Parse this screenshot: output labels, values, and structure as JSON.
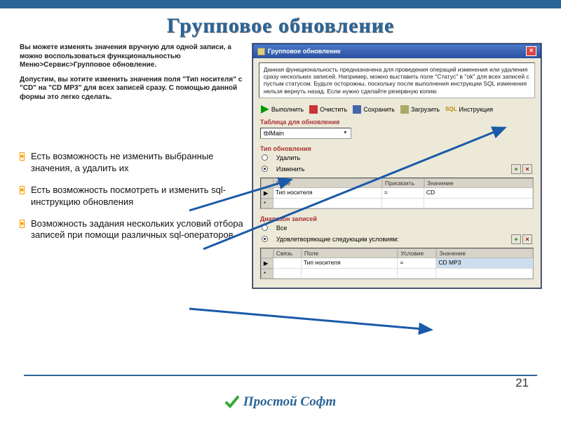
{
  "title": "Групповое обновление",
  "intro": {
    "p1": "Вы можете изменять значения вручную для одной записи, а можно воспользоваться функциональностью Меню>Сервис>Групповое обновление.",
    "p2": "Допустим, вы хотите изменить значения поля \"Тип носителя\" с \"CD\" на \"CD MP3\" для всех записей сразу. С помощью данной формы это легко сделать."
  },
  "bullets": [
    "Есть возможность не изменить выбранные значения, а удалить их",
    "Есть возможность посмотреть и изменить sql-инструкцию обновления",
    "Возможность задания нескольких условий отбора записей при помощи различных sql-операторов"
  ],
  "dialog": {
    "title": "Групповое обновление",
    "info": "Данная функциональность предназначена для проведения операций изменения или удаления сразу нескольких записей. Например, можно выставить поле \"Статус\" в \"ok\" для всех записей с пустым статусом. Будьте осторожны, поскольку после выполнения инструкции SQL изменения нельзя вернуть назад. Если нужно сделайте резервную копию",
    "toolbar": {
      "run": "Выполнить",
      "clear": "Очистить",
      "save": "Сохранить",
      "load": "Загрузить",
      "sql": "Инструкция",
      "sql_label": "SQL"
    },
    "sec1": "Таблица для обновления",
    "table_value": "tblMain",
    "sec2": "Тип обновления",
    "radio_delete": "Удалить",
    "radio_update": "Изменить",
    "grid1": {
      "h1": "Поле",
      "h2": "Присвоить",
      "h3": "Значение",
      "r1c1": "Тип носителя",
      "r1c2": "=",
      "r1c3": "CD"
    },
    "sec3": "Диапазон записей",
    "radio_all": "Все",
    "radio_cond": "Удовлетворяющие следующим условиям:",
    "grid2": {
      "h0": "Связь",
      "h1": "Поле",
      "h2": "Условие",
      "h3": "Значение",
      "r1c1": "Тип носителя",
      "r1c2": "=",
      "r1c3": "CD MP3"
    }
  },
  "footer": "Простой Софт",
  "page": "21"
}
